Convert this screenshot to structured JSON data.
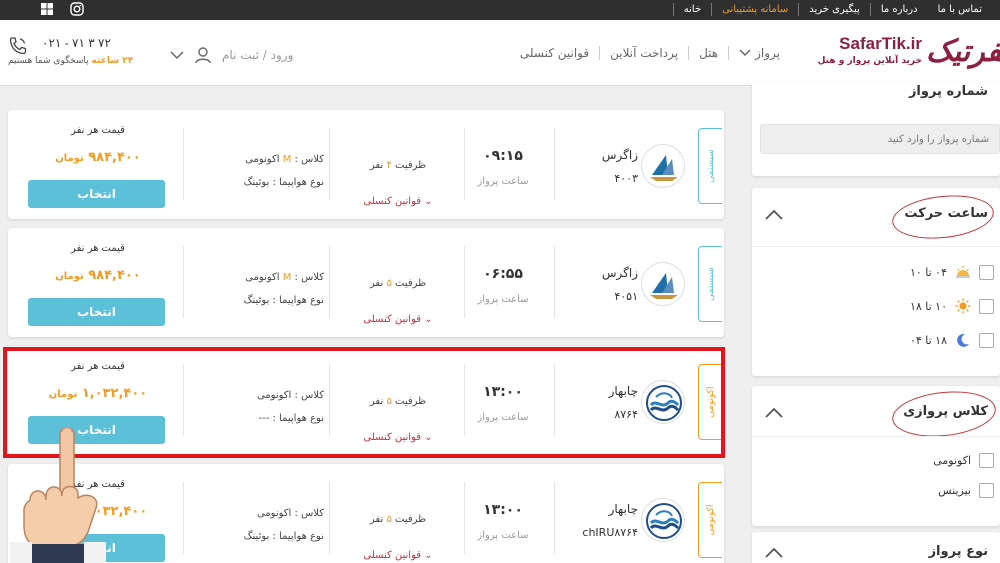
{
  "topbar": {
    "nav": [
      {
        "label": "خانه",
        "active": false
      },
      {
        "label": "سامانه پشتیبانی",
        "active": true
      },
      {
        "label": "پیگیری خرید",
        "active": false
      },
      {
        "label": "درباره ما",
        "active": false
      },
      {
        "label": "تماس با ما",
        "active": false
      }
    ],
    "social": [
      "instagram-icon",
      "windows-icon"
    ]
  },
  "header": {
    "brand": {
      "name": "SafarTik.ir",
      "tagline": "خرید آنلاین پرواز و هتل",
      "mark": "سفرتیک"
    },
    "nav": [
      {
        "label": "پرواز"
      },
      {
        "label": "هتل"
      },
      {
        "label": "پرداخت آنلاین"
      },
      {
        "label": "قوانین کنسلی"
      }
    ],
    "login": "ورود / ثبت نام",
    "phone": "۰۲۱ - ۷۱ ۳ ۷۲",
    "support_hours": "۲۴ ساعته",
    "support_text": "پاسخگوی شما هستیم"
  },
  "common": {
    "price_label": "قیمت هر نفر",
    "select_label": "انتخاب",
    "currency": "تومان",
    "time_label": "ساعت پرواز",
    "rules": "قوانین کنسلی",
    "capacity_prefix": "ظرفیت",
    "capacity_suffix": "نفر",
    "class_prefix": "کلاس :",
    "aircraft_prefix": "نوع هواپیما :"
  },
  "flights": [
    {
      "tag": "سیستمی",
      "tag_type": "system",
      "airline": "زاگرس",
      "flight_no": "۴۰۰۳",
      "time": "۰۹:۱۵",
      "capacity": "۴",
      "class_code": "M",
      "class_name": "اکونومی",
      "aircraft": "بوئینگ",
      "price": "۹۸۴,۴۰۰"
    },
    {
      "tag": "سیستمی",
      "tag_type": "system",
      "airline": "زاگرس",
      "flight_no": "۴۰۵۱",
      "time": "۰۶:۵۵",
      "capacity": "۵",
      "class_code": "M",
      "class_name": "اکونومی",
      "aircraft": "بوئینگ",
      "price": "۹۸۴,۴۰۰"
    },
    {
      "tag": "اکونومی",
      "tag_type": "charter",
      "airline": "چابهار",
      "flight_no": "۸۷۶۴",
      "time": "۱۳:۰۰",
      "capacity": "۵",
      "class_code": "",
      "class_name": "اکونومی",
      "aircraft": "---",
      "price": "۱,۰۳۲,۴۰۰"
    },
    {
      "tag": "اکونومی",
      "tag_type": "charter",
      "airline": "چابهار",
      "flight_no": "chIRU۸۷۶۴",
      "time": "۱۳:۰۰",
      "capacity": "۵",
      "class_code": "",
      "class_name": "اکونومی",
      "aircraft": "بوئینگ",
      "price": "۱,۰۳۲,۴۰۰"
    }
  ],
  "sidebar": {
    "flight_number": {
      "title": "شماره پرواز",
      "placeholder": "شماره پرواز را وارد کنید"
    },
    "departure_time": {
      "title": "ساعت حرکت",
      "options": [
        {
          "label": "۰۴ تا ۱۰",
          "icon": "sunrise-icon"
        },
        {
          "label": "۱۰ تا ۱۸",
          "icon": "sun-icon"
        },
        {
          "label": "۱۸ تا ۰۴",
          "icon": "moon-icon"
        }
      ]
    },
    "flight_class": {
      "title": "کلاس پروازی",
      "options": [
        {
          "label": "اکونومی"
        },
        {
          "label": "بیزینس"
        }
      ]
    },
    "flight_type": {
      "title": "نوع پرواز"
    }
  },
  "colors": {
    "accent": "#f39a1f",
    "button": "#5bc0d8",
    "brand": "#8a2140",
    "highlight": "#e0161d",
    "rules": "#c8303a"
  }
}
